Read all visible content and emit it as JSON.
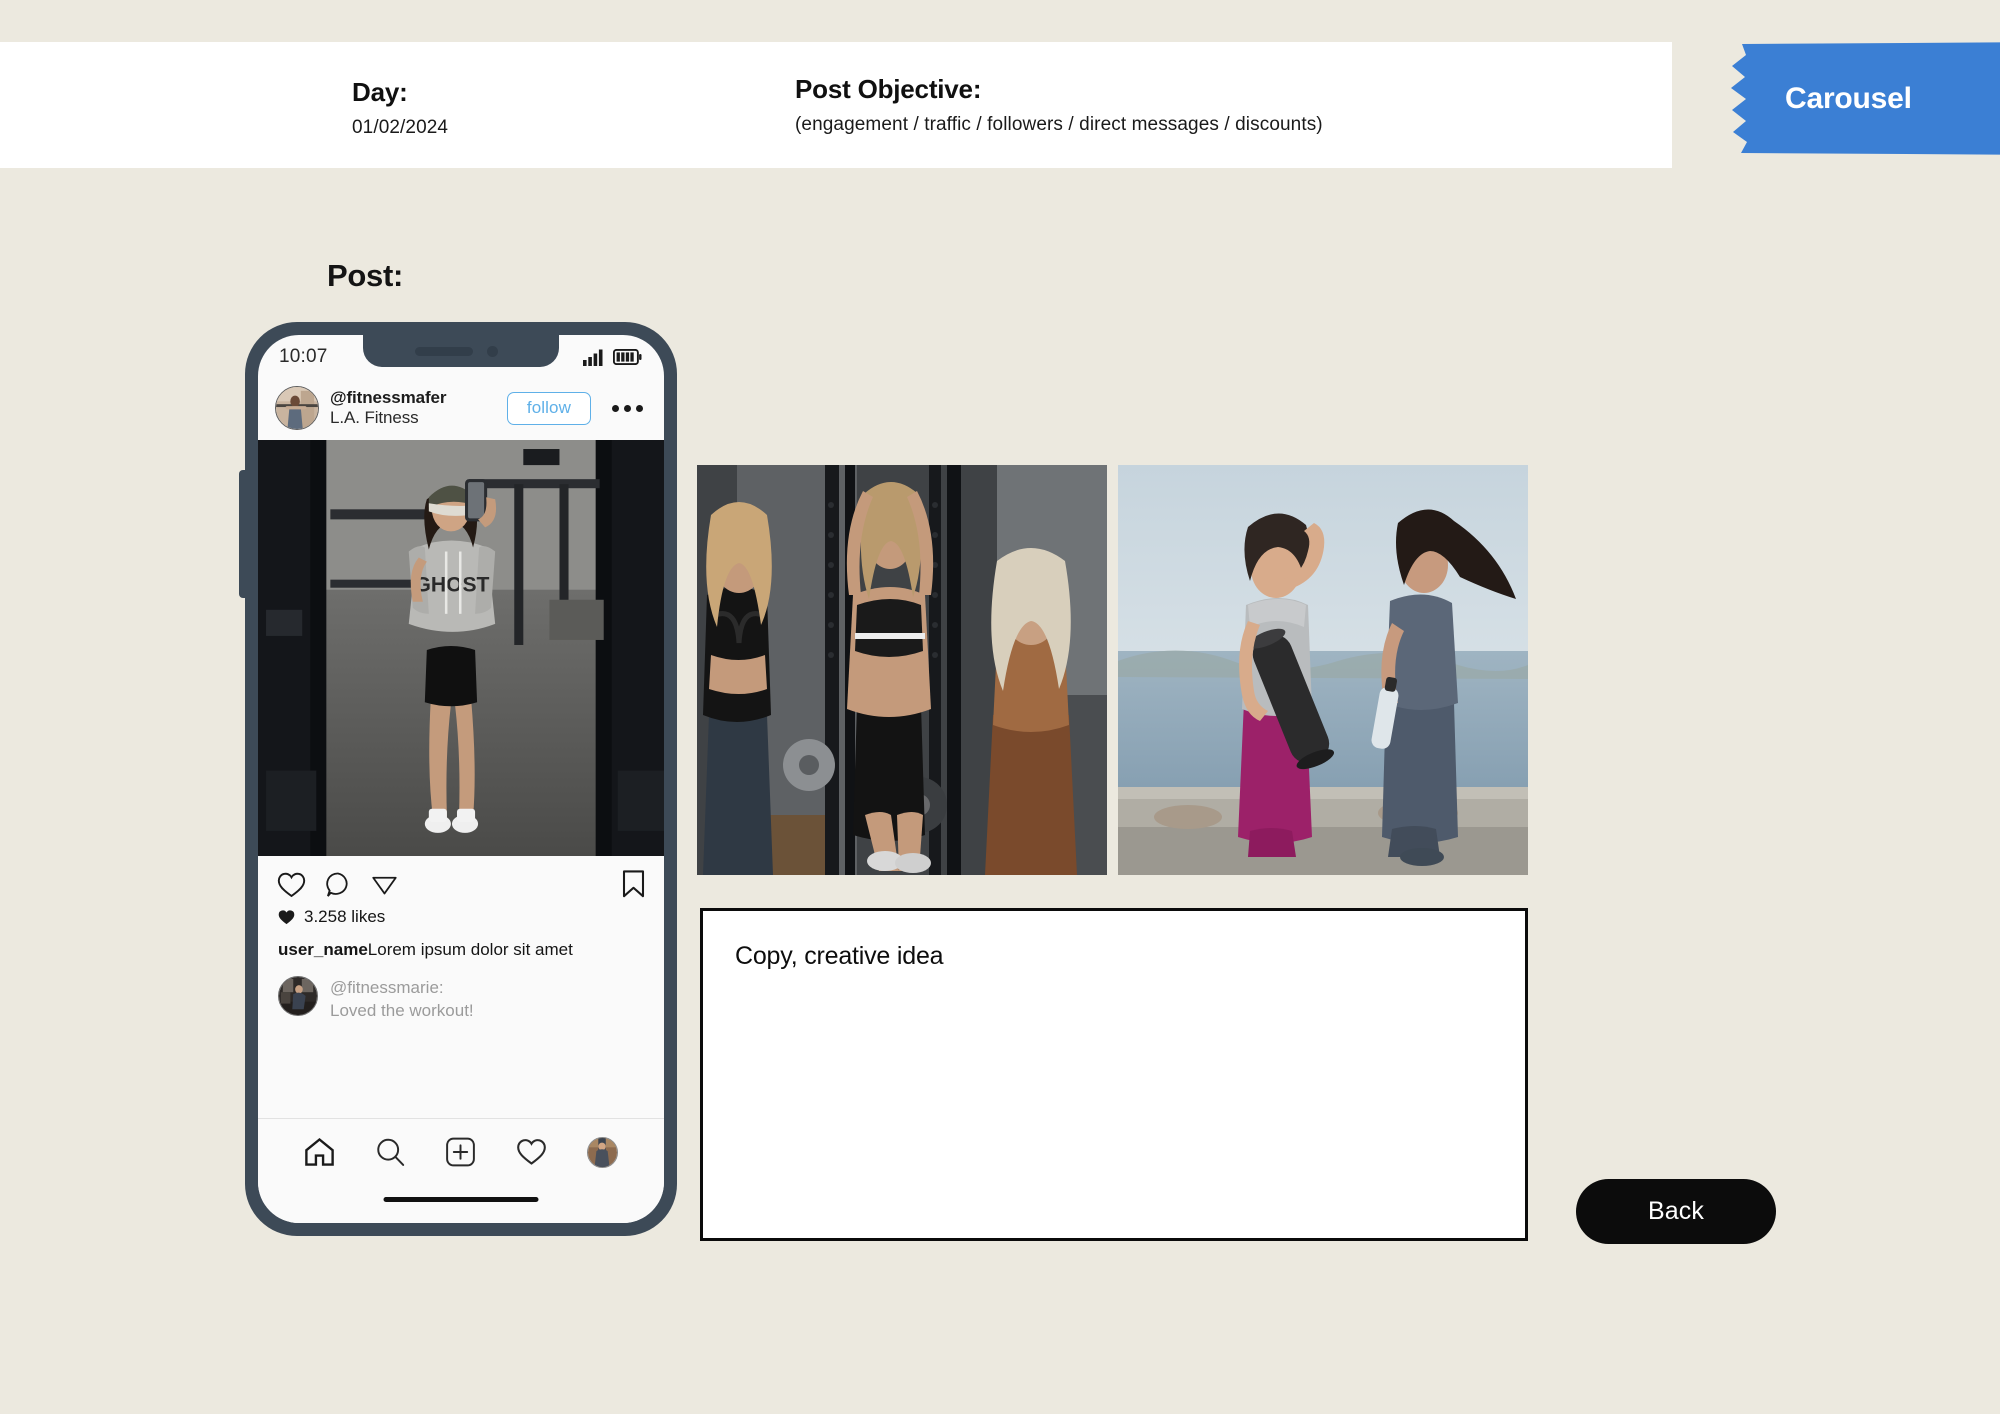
{
  "page": {
    "background_color": "#ECE9DF",
    "accent_blue": "#3B7FD4",
    "phone_frame_color": "#3D4A57"
  },
  "header": {
    "day": {
      "label": "Day:",
      "value": "01/02/2024"
    },
    "objective": {
      "label": "Post Objective:",
      "value": "(engagement / traffic / followers / direct messages / discounts)"
    },
    "badge": {
      "label": "Carousel",
      "color": "#3B7FD4"
    }
  },
  "post_section": {
    "title": "Post:"
  },
  "phone": {
    "status": {
      "time": "10:07",
      "signal_icon": "signal-bars-icon",
      "battery_icon": "battery-icon"
    },
    "post_header": {
      "handle": "@fitnessmafer",
      "subtitle": "L.A. Fitness",
      "follow_label": "follow",
      "more_icon": "more-options-icon"
    },
    "photo": {
      "alt_name": "gym-mirror-selfie-photo"
    },
    "actions": {
      "like_icon": "heart-icon",
      "comment_icon": "comment-bubble-icon",
      "share_icon": "share-paper-plane-icon",
      "save_icon": "bookmark-icon"
    },
    "likes": {
      "count_text": "3.258 likes",
      "icon": "filled-heart-icon"
    },
    "caption": {
      "username": "user_name",
      "text": "Lorem ipsum dolor sit amet"
    },
    "comment": {
      "username": "@fitnessmarie:",
      "text": "Loved the workout!"
    },
    "nav": {
      "home_icon": "home-icon",
      "search_icon": "search-icon",
      "create_icon": "plus-square-icon",
      "activity_icon": "heart-icon",
      "profile_icon": "profile-avatar-icon"
    }
  },
  "carousel": {
    "thumbnails": [
      {
        "name": "gym-group-workout-photo"
      },
      {
        "name": "outdoor-seaside-fitness-photo"
      }
    ]
  },
  "copy_box": {
    "label": "Copy, creative idea",
    "value": ""
  },
  "back_button": {
    "label": "Back"
  }
}
